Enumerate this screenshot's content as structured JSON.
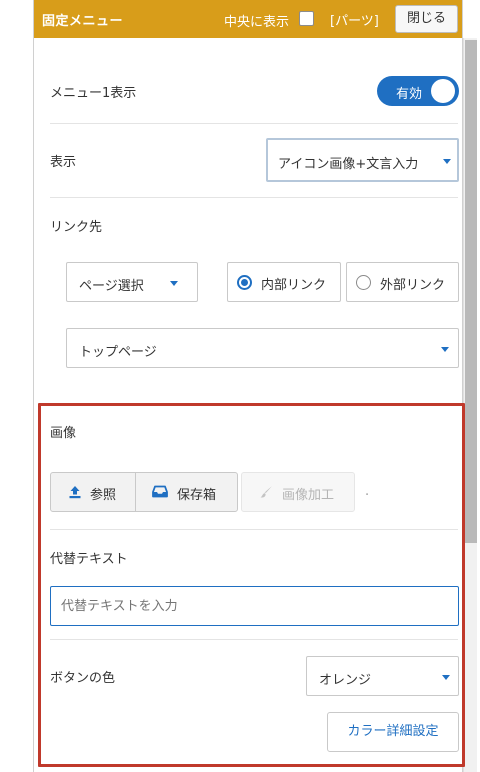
{
  "header": {
    "title": "固定メニュー",
    "center_label": "中央に表示",
    "parts_label": "[パーツ]",
    "close_label": "閉じる"
  },
  "menu1": {
    "label": "メニュー1表示",
    "toggle_label": "有効",
    "toggle_on": true
  },
  "display": {
    "label": "表示",
    "selected": "アイコン画像+文言入力"
  },
  "link": {
    "label": "リンク先",
    "page_select": "ページ選択",
    "radio_internal": "内部リンク",
    "radio_external": "外部リンク",
    "selected_radio": "内部リンク",
    "destination": "トップページ"
  },
  "image": {
    "label": "画像",
    "browse_label": "参照",
    "storage_label": "保存箱",
    "edit_label": "画像加工",
    "separator": "."
  },
  "alt_text": {
    "label": "代替テキスト",
    "placeholder": "代替テキストを入力"
  },
  "button_color": {
    "label": "ボタンの色",
    "selected": "オレンジ",
    "detail_label": "カラー詳細設定"
  },
  "colors": {
    "header_bg": "#d89d1a",
    "accent": "#1f6fc2",
    "highlight_border": "#c0392b"
  }
}
